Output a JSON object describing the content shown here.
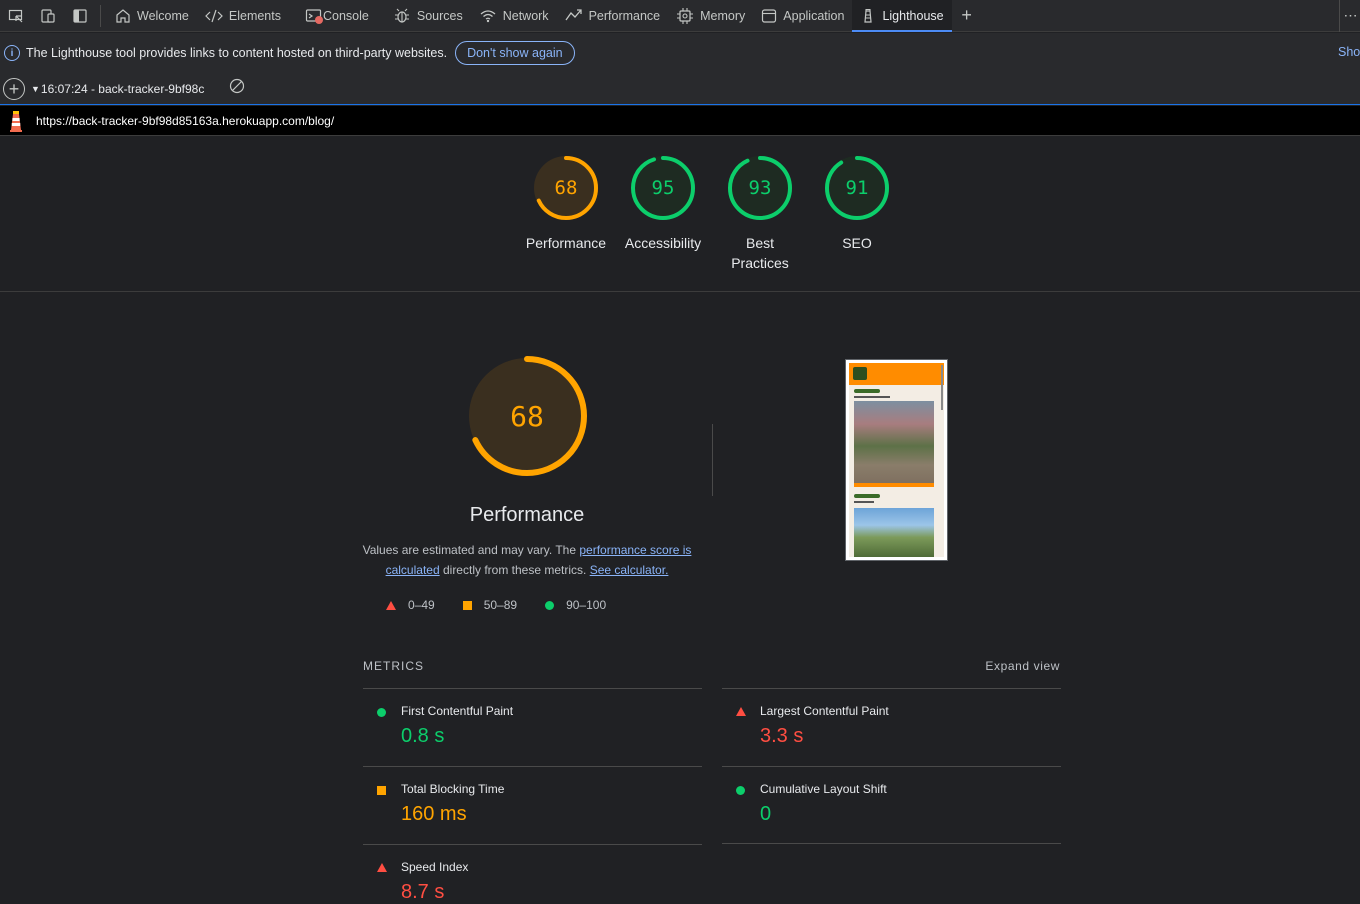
{
  "toolbar": {
    "tabs": [
      {
        "label": "Welcome",
        "icon": "home-icon"
      },
      {
        "label": "Elements",
        "icon": "code-icon"
      },
      {
        "label": "Console",
        "icon": "console-icon"
      },
      {
        "label": "Sources",
        "icon": "bug-icon"
      },
      {
        "label": "Network",
        "icon": "wifi-icon"
      },
      {
        "label": "Performance",
        "icon": "performance-icon"
      },
      {
        "label": "Memory",
        "icon": "memory-chip-icon"
      },
      {
        "label": "Application",
        "icon": "application-icon"
      },
      {
        "label": "Lighthouse",
        "icon": "lighthouse-icon"
      }
    ],
    "active_tab": "Lighthouse"
  },
  "infobar": {
    "message": "The Lighthouse tool provides links to content hosted on third-party websites.",
    "dont_show_label": "Don't show again",
    "show_label": "Show"
  },
  "reportbar": {
    "selected_report": "16:07:24 - back-tracker-9bf98c"
  },
  "urlbar": {
    "url": "https://back-tracker-9bf98d85163a.herokuapp.com/blog/"
  },
  "categories": [
    {
      "score": 68,
      "label": "Performance",
      "rating": "average"
    },
    {
      "score": 95,
      "label": "Accessibility",
      "rating": "pass"
    },
    {
      "score": 93,
      "label": "Best Practices",
      "rating": "pass"
    },
    {
      "score": 91,
      "label": "SEO",
      "rating": "pass"
    }
  ],
  "performance": {
    "score": 68,
    "title": "Performance",
    "desc_prefix": "Values are estimated and may vary. The ",
    "desc_link1": "performance score is calculated",
    "desc_middle": " directly from these metrics. ",
    "desc_link2": "See calculator."
  },
  "legend": {
    "fail": "0–49",
    "average": "50–89",
    "pass": "90–100"
  },
  "metrics": {
    "header": "METRICS",
    "expand_label": "Expand view",
    "items": [
      {
        "name": "First Contentful Paint",
        "value": "0.8 s",
        "rating": "pass"
      },
      {
        "name": "Largest Contentful Paint",
        "value": "3.3 s",
        "rating": "fail"
      },
      {
        "name": "Total Blocking Time",
        "value": "160 ms",
        "rating": "average"
      },
      {
        "name": "Cumulative Layout Shift",
        "value": "0",
        "rating": "pass"
      },
      {
        "name": "Speed Index",
        "value": "8.7 s",
        "rating": "fail"
      }
    ]
  },
  "colors": {
    "pass": "#0cce6b",
    "average": "#ffa400",
    "fail": "#ff4e42",
    "accent": "#8ab4f8"
  }
}
